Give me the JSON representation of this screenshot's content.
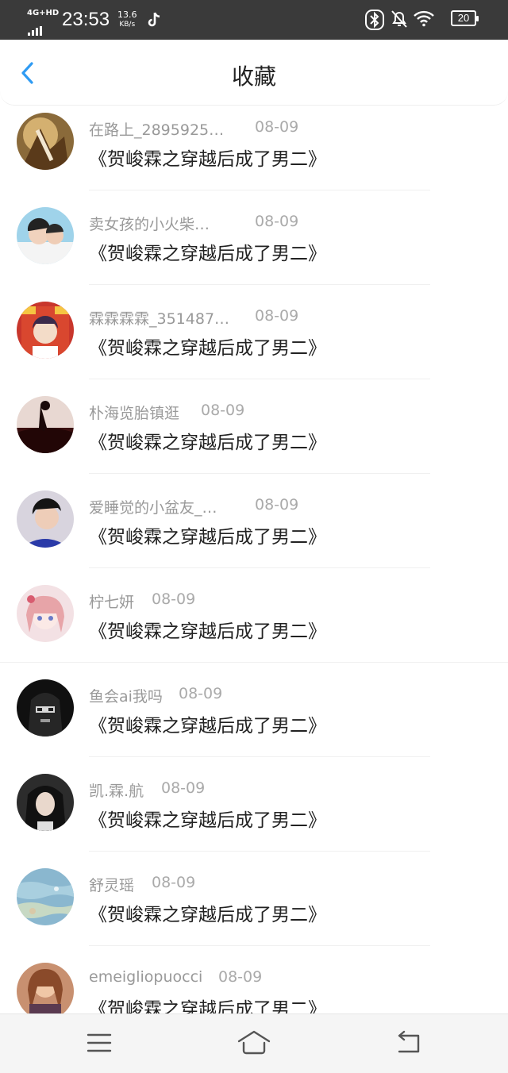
{
  "status_bar": {
    "network": "4G+HD",
    "time": "23:53",
    "speed_value": "13.6",
    "speed_unit": "KB/s",
    "battery": "20",
    "icons": [
      "tiktok-icon",
      "bluetooth-icon",
      "mute-icon",
      "wifi-icon",
      "battery-icon"
    ]
  },
  "header": {
    "title": "收藏",
    "back_icon": "chevron-left-icon",
    "accent_color": "#2f9bf3"
  },
  "favorites": [
    {
      "user": "在路上_2895925…",
      "date": "08-09",
      "title": "《贺峻霖之穿越后成了男二》",
      "avatar": "avatar-1"
    },
    {
      "user": "卖女孩的小火柴…",
      "date": "08-09",
      "title": "《贺峻霖之穿越后成了男二》",
      "avatar": "avatar-2"
    },
    {
      "user": "霖霖霖霖_351487…",
      "date": "08-09",
      "title": "《贺峻霖之穿越后成了男二》",
      "avatar": "avatar-3"
    },
    {
      "user": "朴海览胎镇逛",
      "date": "08-09",
      "title": "《贺峻霖之穿越后成了男二》",
      "avatar": "avatar-4"
    },
    {
      "user": "爱睡觉的小盆友_…",
      "date": "08-09",
      "title": "《贺峻霖之穿越后成了男二》",
      "avatar": "avatar-5"
    },
    {
      "user": "柠七妍",
      "date": "08-09",
      "title": "《贺峻霖之穿越后成了男二》",
      "avatar": "avatar-6"
    },
    {
      "user": "鱼会ai我吗",
      "date": "08-09",
      "title": "《贺峻霖之穿越后成了男二》",
      "avatar": "avatar-7"
    },
    {
      "user": "凯.霖.航",
      "date": "08-09",
      "title": "《贺峻霖之穿越后成了男二》",
      "avatar": "avatar-8"
    },
    {
      "user": "舒灵瑶",
      "date": "08-09",
      "title": "《贺峻霖之穿越后成了男二》",
      "avatar": "avatar-9"
    },
    {
      "user": "emeigliopuocci",
      "date": "08-09",
      "title": "《贺峻霖之穿越后成了男二》",
      "avatar": "avatar-10"
    }
  ],
  "bottom_nav": {
    "icons": [
      "menu-icon",
      "home-icon",
      "back-icon"
    ]
  }
}
